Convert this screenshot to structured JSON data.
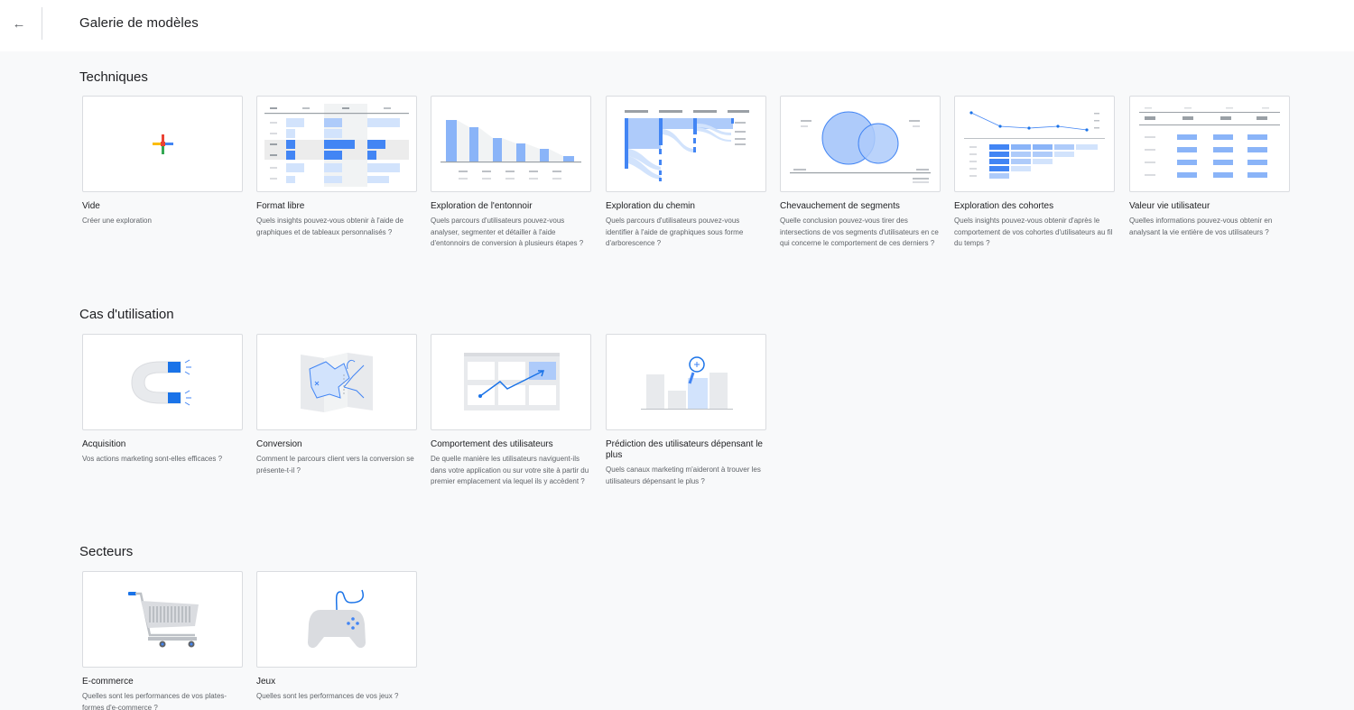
{
  "header": {
    "title": "Galerie de modèles",
    "back_icon": "arrow-back-icon",
    "back_glyph": "←"
  },
  "sections": [
    {
      "title": "Techniques",
      "cards": [
        {
          "title": "Vide",
          "desc": "Créer une exploration",
          "icon": "plus-icon"
        },
        {
          "title": "Format libre",
          "desc": "Quels insights pouvez-vous obtenir à l'aide de graphiques et de tableaux personnalisés ?",
          "icon": "free-form-table-icon"
        },
        {
          "title": "Exploration de l'entonnoir",
          "desc": "Quels parcours d'utilisateurs pouvez-vous analyser, segmenter et détailler à l'aide d'entonnoirs de conversion à plusieurs étapes ?",
          "icon": "funnel-chart-icon"
        },
        {
          "title": "Exploration du chemin",
          "desc": "Quels parcours d'utilisateurs pouvez-vous identifier à l'aide de graphiques sous forme d'arborescence ?",
          "icon": "path-tree-icon"
        },
        {
          "title": "Chevauchement de segments",
          "desc": "Quelle conclusion pouvez-vous tirer des intersections de vos segments d'utilisateurs en ce qui concerne le comportement de ces derniers ?",
          "icon": "venn-diagram-icon"
        },
        {
          "title": "Exploration des cohortes",
          "desc": "Quels insights pouvez-vous obtenir d'après le comportement de vos cohortes d'utilisateurs au fil du temps ?",
          "icon": "cohort-chart-icon"
        },
        {
          "title": "Valeur vie utilisateur",
          "desc": "Quelles informations pouvez-vous obtenir en analysant la vie entière de vos utilisateurs ?",
          "icon": "lifetime-table-icon"
        }
      ]
    },
    {
      "title": "Cas d'utilisation",
      "cards": [
        {
          "title": "Acquisition",
          "desc": "Vos actions marketing sont-elles efficaces ?",
          "icon": "magnet-icon"
        },
        {
          "title": "Conversion",
          "desc": "Comment le parcours client vers la conversion se présente-t-il ?",
          "icon": "map-icon"
        },
        {
          "title": "Comportement des utilisateurs",
          "desc": "De quelle manière les utilisateurs naviguent-ils dans votre application ou sur votre site à partir du premier emplacement via lequel ils y accèdent ?",
          "icon": "trend-grid-icon"
        },
        {
          "title": "Prédiction des utilisateurs dépensant le plus",
          "desc": "Quels canaux marketing m'aideront à trouver les utilisateurs dépensant le plus ?",
          "icon": "bar-magnifier-icon"
        }
      ]
    },
    {
      "title": "Secteurs",
      "cards": [
        {
          "title": "E-commerce",
          "desc": "Quelles sont les performances de vos plates-formes d'e-commerce ?",
          "icon": "shopping-cart-icon"
        },
        {
          "title": "Jeux",
          "desc": "Quelles sont les performances de vos jeux ?",
          "icon": "game-controller-icon"
        }
      ]
    }
  ],
  "colors": {
    "accent": "#4285f4",
    "accent_light": "#aecbfa",
    "accent_pale": "#d2e3fc",
    "grey": "#dadce0",
    "text": "#202124",
    "muted": "#5f6368"
  }
}
